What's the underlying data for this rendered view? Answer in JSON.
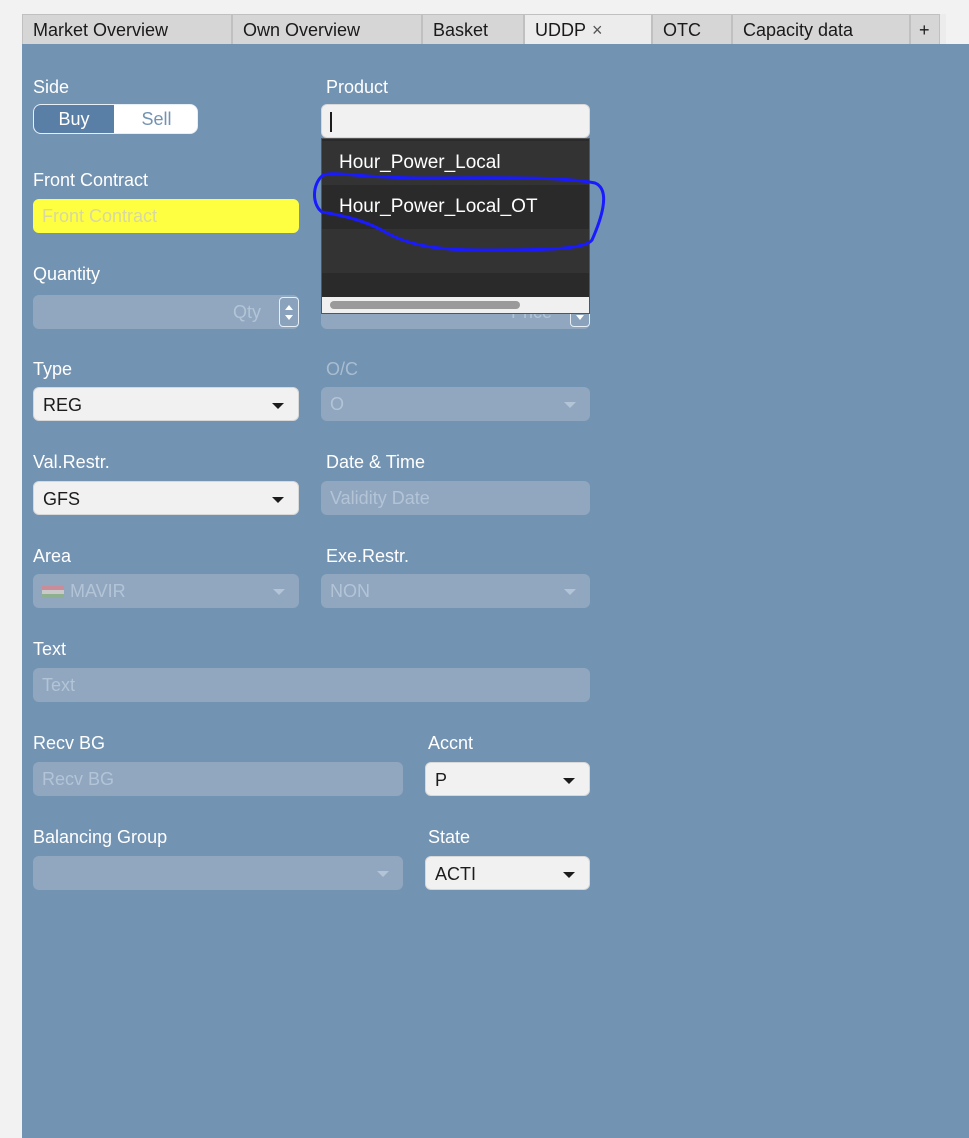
{
  "tabs": [
    {
      "label": "Market Overview"
    },
    {
      "label": "Own Overview"
    },
    {
      "label": "Basket"
    },
    {
      "label": "UDDP",
      "close": "×"
    },
    {
      "label": "OTC"
    },
    {
      "label": "Capacity data"
    },
    {
      "label": "+"
    }
  ],
  "form": {
    "side": {
      "label": "Side",
      "buy": "Buy",
      "sell": "Sell",
      "selected": "Buy"
    },
    "product": {
      "label": "Product",
      "value": ""
    },
    "front_contract": {
      "label": "Front Contract",
      "placeholder": "Front Contract"
    },
    "quantity": {
      "label": "Quantity",
      "placeholder": "Qty"
    },
    "price": {
      "placeholder": "Price"
    },
    "type": {
      "label": "Type",
      "value": "REG"
    },
    "oc": {
      "label": "O/C",
      "value": "O"
    },
    "val_restr": {
      "label": "Val.Restr.",
      "value": "GFS"
    },
    "date_time": {
      "label": "Date & Time",
      "placeholder": "Validity Date"
    },
    "area": {
      "label": "Area",
      "value": "MAVIR"
    },
    "exe_restr": {
      "label": "Exe.Restr.",
      "value": "NON"
    },
    "text": {
      "label": "Text",
      "placeholder": "Text"
    },
    "recv_bg": {
      "label": "Recv BG",
      "placeholder": "Recv BG"
    },
    "accnt": {
      "label": "Accnt",
      "value": "P"
    },
    "balancing_group": {
      "label": "Balancing Group",
      "value": ""
    },
    "state": {
      "label": "State",
      "value": "ACTI"
    }
  },
  "product_dropdown": {
    "options": [
      "Hour_Power_Local",
      "Hour_Power_Local_OT"
    ]
  },
  "colors": {
    "panel": "#7393b3",
    "highlight_input": "#ffff42",
    "annotation": "#1a1aff",
    "dropdown_bg": "#2a2a2a"
  }
}
